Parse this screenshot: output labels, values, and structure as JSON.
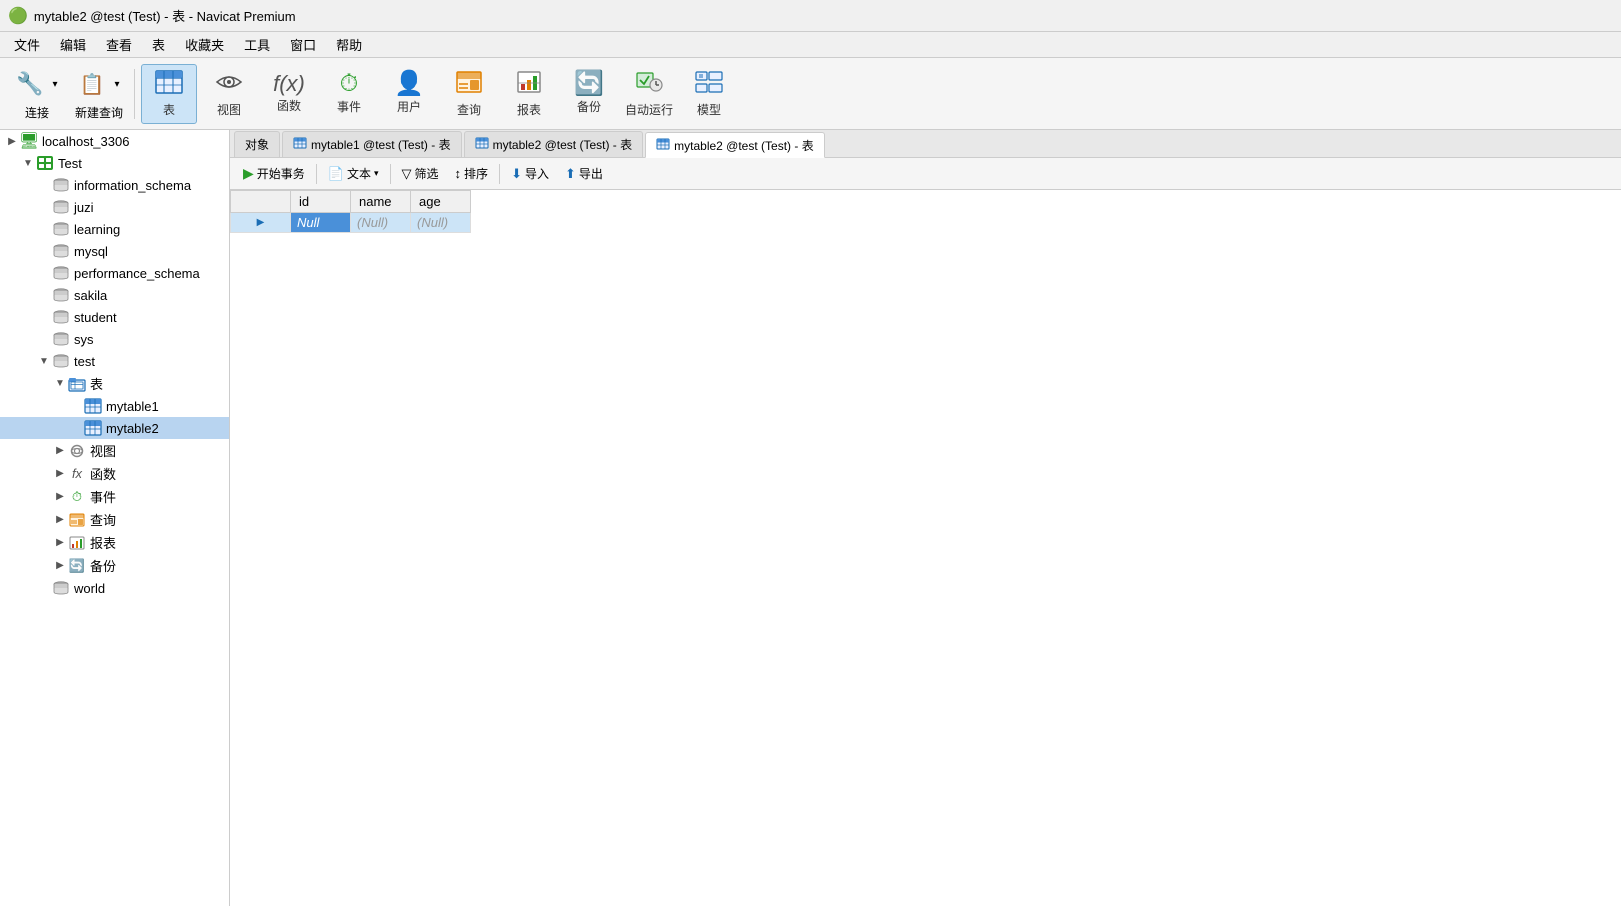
{
  "window": {
    "title": "mytable2 @test (Test) - 表 - Navicat Premium",
    "icon": "🟢"
  },
  "menubar": {
    "items": [
      "文件",
      "编辑",
      "查看",
      "表",
      "收藏夹",
      "工具",
      "窗口",
      "帮助"
    ]
  },
  "toolbar": {
    "connect_label": "连接",
    "new_query_label": "新建查询",
    "table_label": "表",
    "view_label": "视图",
    "function_label": "函数",
    "event_label": "事件",
    "user_label": "用户",
    "query_label": "查询",
    "report_label": "报表",
    "backup_label": "备份",
    "auto_run_label": "自动运行",
    "model_label": "模型"
  },
  "tabs": [
    {
      "label": "mytable1 @test (Test) - 表",
      "active": false
    },
    {
      "label": "mytable2 @test (Test) - 表",
      "active": false
    },
    {
      "label": "mytable2 @test (Test) - 表",
      "active": true
    }
  ],
  "table_toolbar": {
    "begin_transaction": "开始事务",
    "text_btn": "文本",
    "filter_btn": "筛选",
    "sort_btn": "排序",
    "import_btn": "导入",
    "export_btn": "导出"
  },
  "table": {
    "columns": [
      "",
      "id",
      "name",
      "age"
    ],
    "rows": [
      {
        "arrow": "▶",
        "id": "Null",
        "id_selected": true,
        "name": "(Null)",
        "age": "(Null)"
      }
    ]
  },
  "sidebar": {
    "connections": [
      {
        "label": "localhost_3306",
        "icon": "server",
        "expanded": false,
        "level": 0
      }
    ],
    "tree": [
      {
        "label": "localhost_3306",
        "icon": "server",
        "expanded": false,
        "level": 0,
        "indent": 0
      },
      {
        "label": "Test",
        "icon": "server-green",
        "expanded": true,
        "level": 1,
        "indent": 1
      },
      {
        "label": "information_schema",
        "icon": "db",
        "level": 2,
        "indent": 2
      },
      {
        "label": "juzi",
        "icon": "db",
        "level": 2,
        "indent": 2
      },
      {
        "label": "learning",
        "icon": "db",
        "level": 2,
        "indent": 2
      },
      {
        "label": "mysql",
        "icon": "db",
        "level": 2,
        "indent": 2
      },
      {
        "label": "performance_schema",
        "icon": "db",
        "level": 2,
        "indent": 2
      },
      {
        "label": "sakila",
        "icon": "db",
        "level": 2,
        "indent": 2
      },
      {
        "label": "student",
        "icon": "db",
        "level": 2,
        "indent": 2
      },
      {
        "label": "sys",
        "icon": "db",
        "level": 2,
        "indent": 2
      },
      {
        "label": "test",
        "icon": "db",
        "level": 2,
        "indent": 2,
        "expanded": true
      },
      {
        "label": "表",
        "icon": "folder-table",
        "level": 3,
        "indent": 3,
        "expanded": true
      },
      {
        "label": "mytable1",
        "icon": "table",
        "level": 4,
        "indent": 4
      },
      {
        "label": "mytable2",
        "icon": "table",
        "level": 4,
        "indent": 4,
        "selected": true
      },
      {
        "label": "视图",
        "icon": "view",
        "level": 3,
        "indent": 3
      },
      {
        "label": "函数",
        "icon": "function",
        "level": 3,
        "indent": 3
      },
      {
        "label": "事件",
        "icon": "event",
        "level": 3,
        "indent": 3
      },
      {
        "label": "查询",
        "icon": "query",
        "level": 3,
        "indent": 3
      },
      {
        "label": "报表",
        "icon": "report",
        "level": 3,
        "indent": 3
      },
      {
        "label": "备份",
        "icon": "backup",
        "level": 3,
        "indent": 3
      },
      {
        "label": "world",
        "icon": "db",
        "level": 2,
        "indent": 2
      }
    ]
  }
}
